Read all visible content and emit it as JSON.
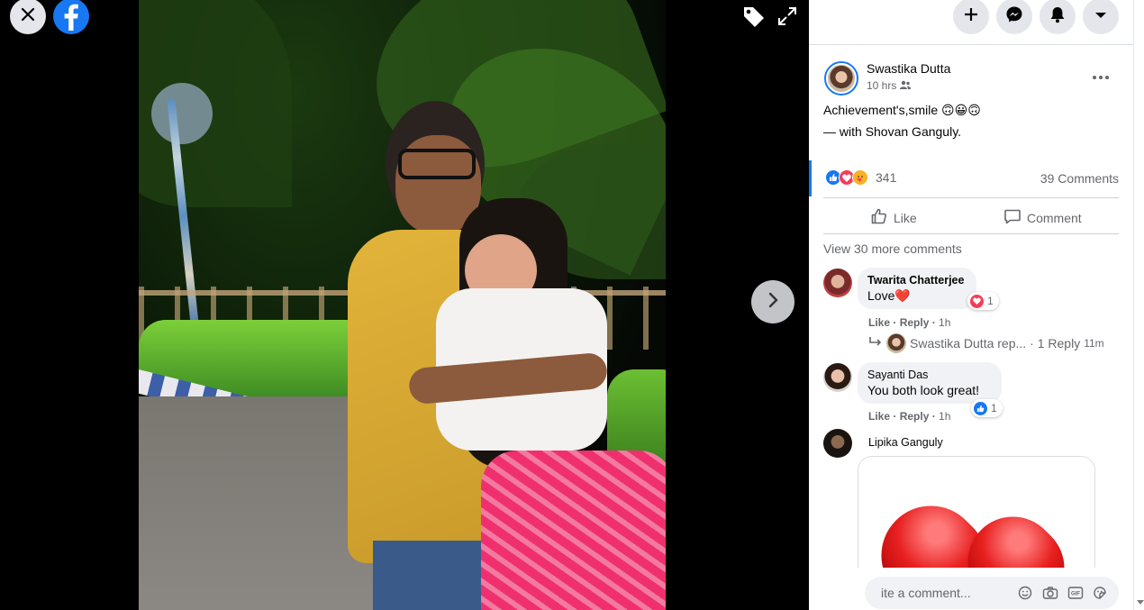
{
  "viewer": {
    "close_icon": "close-icon",
    "logo_icon": "facebook-logo-icon",
    "tag_icon": "tag-icon",
    "expand_icon": "expand-icon",
    "next_icon": "chevron-right-icon"
  },
  "topbar": {
    "create_icon": "plus-icon",
    "messenger_icon": "messenger-icon",
    "notifications_icon": "bell-icon",
    "account_icon": "caret-down-icon"
  },
  "post": {
    "author": "Swastika Dutta",
    "time": "10 hrs",
    "audience_icon": "friends-icon",
    "caption": "Achievement's,smile 🙃😀🙃",
    "with_prefix": "— with ",
    "tagged": "Shovan Ganguly.",
    "reaction_count": "341",
    "comment_count": "39 Comments",
    "like_label": "Like",
    "comment_label": "Comment",
    "view_more": "View 30 more comments"
  },
  "comments": [
    {
      "author": "Twarita Chatterjee",
      "text": "Love❤️",
      "reaction_count": "1",
      "like": "Like",
      "reply": "Reply",
      "time": "1h"
    },
    {
      "author": "Sayanti Das",
      "text": "You both look great!",
      "reaction_count": "1",
      "like": "Like",
      "reply": "Reply",
      "time": "1h"
    },
    {
      "author": "Lipika Ganguly"
    }
  ],
  "reply_summary": {
    "text": "Swastika Dutta rep...",
    "count": "· 1 Reply",
    "time": "11m"
  },
  "composer": {
    "placeholder": "Write a comment...",
    "visible_text": "ite a comment..."
  },
  "colors": {
    "accent": "#1877f2",
    "love": "#f33e58"
  }
}
